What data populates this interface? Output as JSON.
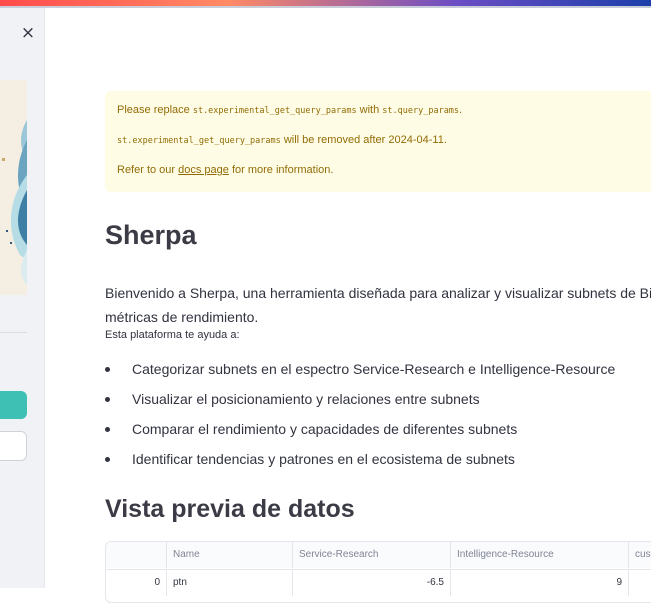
{
  "sidebar": {
    "close_icon": "×"
  },
  "warning": {
    "line1_prefix": "Please replace ",
    "line1_code1": "st.experimental_get_query_params",
    "line1_mid": " with ",
    "line1_code2": "st.query_params",
    "line1_suffix": ".",
    "line2_code": "st.experimental_get_query_params",
    "line2_text": " will be removed after 2024-04-11.",
    "line3_prefix": "Refer to our ",
    "line3_link": "docs page",
    "line3_suffix": " for more information.",
    "color": "#926c05",
    "background": "#fffce6"
  },
  "page": {
    "title": "Sherpa",
    "intro": "Bienvenido a Sherpa, una herramienta diseñada para analizar y visualizar subnets de Bittensor basándose en sus métricas de rendimiento.",
    "intro_line1": "Bienvenido a Sherpa, una herramienta diseñada para analizar y visualizar subnets de Bit",
    "intro_line2": "métricas de rendimiento.",
    "helps_label": "Esta plataforma te ayuda a:",
    "bullets": [
      "Categorizar subnets en el espectro Service-Research e Intelligence-Resource",
      "Visualizar el posicionamiento y relaciones entre subnets",
      "Comparar el rendimiento y capacidades de diferentes subnets",
      "Identificar tendencias y patrones en el ecosistema de subnets"
    ],
    "preview_heading": "Vista previa de datos"
  },
  "table": {
    "columns": [
      "",
      "Name",
      "Service-Research",
      "Intelligence-Resource",
      "cust"
    ],
    "rows": [
      [
        "0",
        "ptn",
        "-6.5",
        "9",
        ""
      ]
    ]
  },
  "colors": {
    "accent_teal": "#3ec1b4",
    "text": "#31333f"
  }
}
